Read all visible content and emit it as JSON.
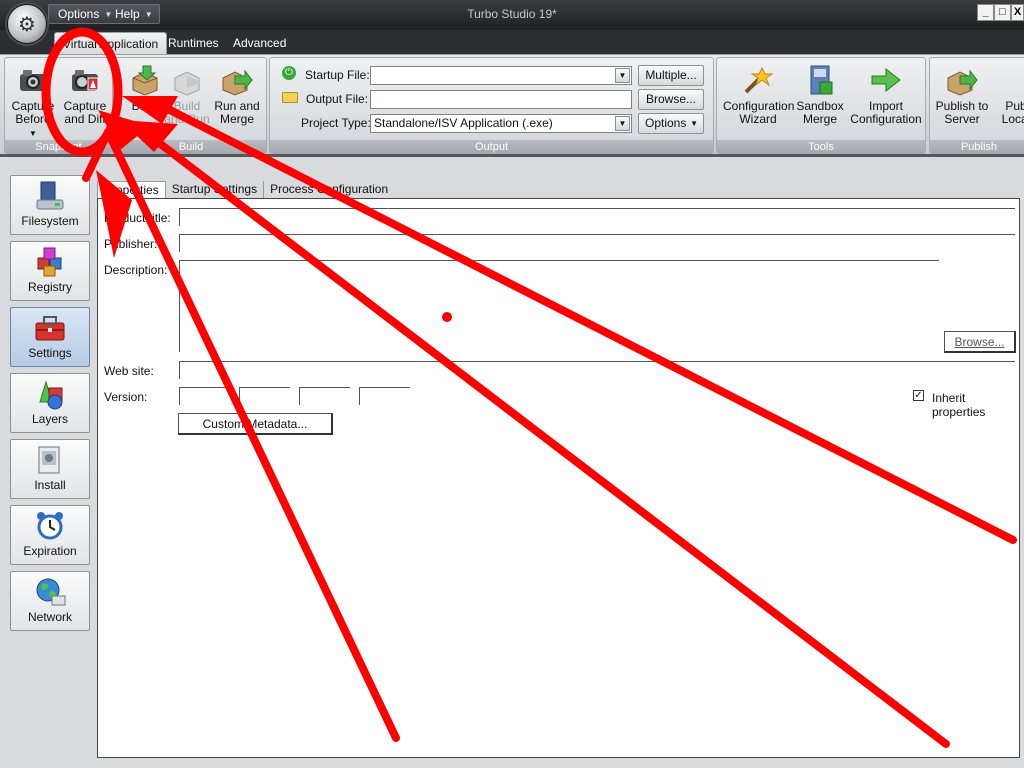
{
  "window": {
    "title": "Turbo Studio 19*",
    "menu": [
      {
        "label": "Options"
      },
      {
        "label": "Help"
      }
    ],
    "controls": {
      "minimize": "_",
      "maximize": "□",
      "close": "X"
    }
  },
  "ribbon_tabs": [
    {
      "label": "Virtual Application",
      "active": true
    },
    {
      "label": "Runtimes"
    },
    {
      "label": "Advanced"
    }
  ],
  "groups": {
    "snapshot": {
      "label": "Snapshot",
      "buttons": [
        {
          "label1": "Capture",
          "label2": "Before",
          "icon": "camera-icon"
        },
        {
          "label1": "Capture",
          "label2": "and Diff",
          "icon": "camera-diff-icon"
        }
      ]
    },
    "build": {
      "label": "Build",
      "buttons": [
        {
          "label1": "Build",
          "label2": "",
          "icon": "build-box-icon"
        },
        {
          "label1": "Build",
          "label2": "and Run",
          "icon": "build-run-icon",
          "disabled": true
        },
        {
          "label1": "Run and",
          "label2": "Merge",
          "icon": "run-merge-icon"
        }
      ]
    },
    "output": {
      "label": "Output",
      "startup_file_label": "Startup File:",
      "output_file_label": "Output File:",
      "project_type_label": "Project Type:",
      "startup_file_value": "",
      "output_file_value": "",
      "project_type_value": "Standalone/ISV Application (.exe)",
      "multiple_button": "Multiple...",
      "browse_button": "Browse...",
      "options_button": "Options"
    },
    "tools": {
      "label": "Tools",
      "buttons": [
        {
          "label1": "Configuration",
          "label2": "Wizard",
          "icon": "wand-icon"
        },
        {
          "label1": "Sandbox",
          "label2": "Merge",
          "icon": "sandbox-merge-icon"
        },
        {
          "label1": "Import",
          "label2": "Configuration",
          "icon": "import-icon"
        }
      ]
    },
    "publish": {
      "label": "Publish",
      "buttons": [
        {
          "label1": "Publish to",
          "label2": "Server",
          "icon": "publish-server-icon"
        },
        {
          "label1": "Pub",
          "label2": "Local",
          "icon": "publish-local-icon"
        }
      ]
    }
  },
  "nav": [
    {
      "label": "Filesystem",
      "icon": "filesystem-icon"
    },
    {
      "label": "Registry",
      "icon": "registry-icon"
    },
    {
      "label": "Settings",
      "icon": "toolbox-icon",
      "active": true
    },
    {
      "label": "Layers",
      "icon": "layers-icon"
    },
    {
      "label": "Install",
      "icon": "install-icon"
    },
    {
      "label": "Expiration",
      "icon": "alarm-clock-icon"
    },
    {
      "label": "Network",
      "icon": "globe-network-icon"
    }
  ],
  "sub_tabs": [
    {
      "label": "Properties",
      "active": true
    },
    {
      "label": "Startup Settings"
    },
    {
      "label": "Process Configuration"
    }
  ],
  "form": {
    "product_title_label": "Product title:",
    "publisher_label": "Publisher:",
    "description_label": "Description:",
    "website_label": "Web site:",
    "version_label": "Version:",
    "browse_button": "Browse...",
    "custom_metadata_button": "Custom Metadata...",
    "inherit_label": "Inherit properties",
    "inherit_checked": true,
    "product_title": "",
    "publisher": "",
    "description": "",
    "website": "",
    "version_parts": [
      "",
      "",
      "",
      ""
    ]
  },
  "annotation": {
    "color": "#ff0000"
  }
}
